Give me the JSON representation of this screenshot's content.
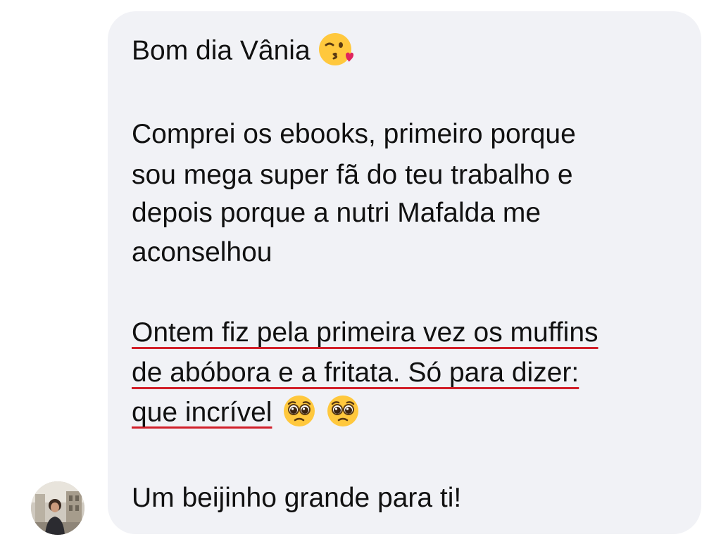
{
  "message": {
    "greeting": "Bom dia Vânia",
    "paragraph1": [
      "Comprei os ebooks, primeiro porque",
      "sou mega super fã do teu trabalho e",
      "depois porque a nutri Mafalda me",
      "aconselhou"
    ],
    "paragraph2": [
      "Ontem fiz pela primeira vez os muffins",
      "de abóbora e a fritata. Só para dizer:",
      "que incrível"
    ],
    "closing": "Um beijinho grande para ti!"
  },
  "icons": {
    "greeting_emoji": "kissing-face-with-heart-icon",
    "pleading_emoji": "pleading-face-icon"
  },
  "colors": {
    "bubble_background": "#f1f2f6",
    "text": "#111111",
    "underline": "#d11f2a",
    "emoji_yellow": "#ffc83d"
  }
}
